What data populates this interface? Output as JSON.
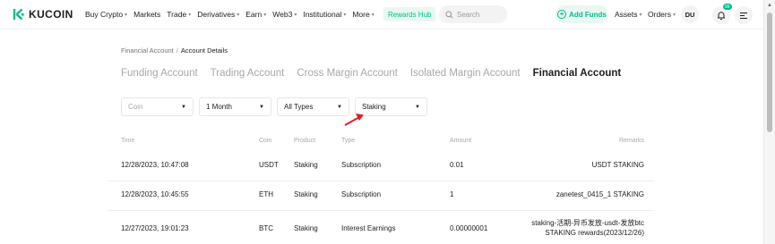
{
  "brand": {
    "name": "KUCOIN"
  },
  "nav": {
    "items": [
      {
        "label": "Buy Crypto",
        "caret": true
      },
      {
        "label": "Markets",
        "caret": false
      },
      {
        "label": "Trade",
        "caret": true
      },
      {
        "label": "Derivatives",
        "caret": true
      },
      {
        "label": "Earn",
        "caret": true
      },
      {
        "label": "Web3",
        "caret": true
      },
      {
        "label": "Institutional",
        "caret": true
      },
      {
        "label": "More",
        "caret": true
      }
    ],
    "rewards_hub": "Rewards Hub",
    "search_placeholder": "Search",
    "add_funds": "Add Funds",
    "assets": "Assets",
    "orders": "Orders",
    "avatar": "DU",
    "notification_badge": "99"
  },
  "breadcrumb": {
    "parent": "Financial Account",
    "separator": "/",
    "current": "Account Details"
  },
  "tabs": [
    {
      "label": "Funding Account",
      "active": false
    },
    {
      "label": "Trading Account",
      "active": false
    },
    {
      "label": "Cross Margin Account",
      "active": false
    },
    {
      "label": "Isolated Margin Account",
      "active": false
    },
    {
      "label": "Financial Account",
      "active": true
    }
  ],
  "filters": {
    "coin": {
      "placeholder": "Coin",
      "value": ""
    },
    "period": {
      "value": "1 Month"
    },
    "types": {
      "value": "All Types"
    },
    "product": {
      "value": "Staking"
    }
  },
  "table": {
    "headers": {
      "time": "Time",
      "coin": "Coin",
      "product": "Product",
      "type": "Type",
      "amount": "Amount",
      "remarks": "Remarks"
    },
    "rows": [
      {
        "time": "12/28/2023, 10:47:08",
        "coin": "USDT",
        "product": "Staking",
        "type": "Subscription",
        "amount": "0.01",
        "remarks_1": "USDT STAKING",
        "remarks_2": ""
      },
      {
        "time": "12/28/2023, 10:45:55",
        "coin": "ETH",
        "product": "Staking",
        "type": "Subscription",
        "amount": "1",
        "remarks_1": "zanetest_0415_1 STAKING",
        "remarks_2": ""
      },
      {
        "time": "12/27/2023, 19:01:23",
        "coin": "BTC",
        "product": "Staking",
        "type": "Interest Earnings",
        "amount": "0.00000001",
        "remarks_1": "staking-活期-异币发放-usdt-发放btc",
        "remarks_2": "STAKING rewards(2023/12/26)"
      }
    ]
  },
  "colors": {
    "accent": "#01bc8d",
    "annotation_arrow": "#e02020"
  }
}
